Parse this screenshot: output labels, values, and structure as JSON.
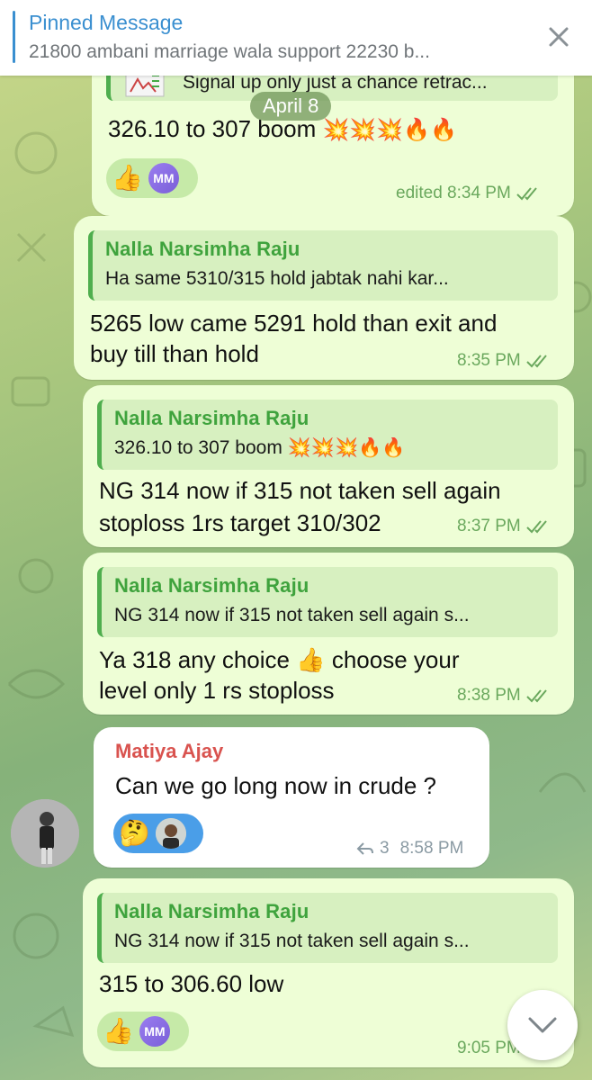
{
  "pinned": {
    "title": "Pinned Message",
    "text": "21800 ambani marriage wala support 22230 b..."
  },
  "date_chip": "April 8",
  "messages": [
    {
      "reply_text": "Signal up only just a chance retrac...",
      "text": "326.10  to 307 boom",
      "emojis": "💥💥💥🔥🔥",
      "reactions": [
        "👍",
        "MM"
      ],
      "time": "edited 8:34 PM"
    },
    {
      "reply_name": "Nalla Narsimha Raju",
      "reply_text": "Ha same 5310/315  hold jabtak nahi kar...",
      "line1": "5265 low came 5291 hold than exit and",
      "line2": "buy till than hold",
      "time": "8:35 PM"
    },
    {
      "reply_name": "Nalla Narsimha Raju",
      "reply_text": "326.10  to 307 boom",
      "reply_emojis": "💥💥💥🔥🔥",
      "line1": "NG 314 now if 315 not taken sell again",
      "line2": "stoploss 1rs target 310/302",
      "time": "8:37 PM"
    },
    {
      "reply_name": "Nalla Narsimha Raju",
      "reply_text": "NG 314 now if 315 not taken sell again s...",
      "line1_a": "Ya 318 any choice",
      "line1_emoji": "👍",
      "line1_b": "choose your",
      "line2": "level only 1 rs stoploss",
      "time": "8:38 PM"
    },
    {
      "sender": "Matiya Ajay",
      "text": "Can we go long now in crude ?",
      "reactions": [
        "🤔"
      ],
      "reply_count": "3",
      "time": "8:58 PM"
    },
    {
      "reply_name": "Nalla Narsimha Raju",
      "reply_text": "NG 314 now if 315 not taken sell again s...",
      "text": "315 to 306.60 low",
      "reactions": [
        "👍",
        "MM"
      ],
      "time": "9:05 PM"
    }
  ],
  "colors": {
    "accent_blue": "#3a8fd0",
    "reply_green": "#3fa33d",
    "outgoing_bubble": "#eefed6",
    "sender_red": "#d9534f"
  }
}
